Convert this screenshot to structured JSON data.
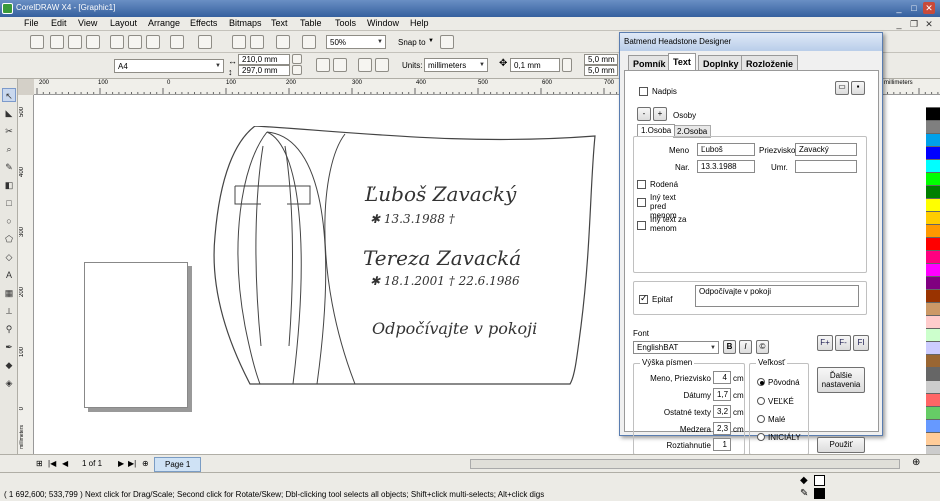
{
  "window": {
    "title": "CorelDRAW X4 - [Graphic1]"
  },
  "menu": [
    "File",
    "Edit",
    "View",
    "Layout",
    "Arrange",
    "Effects",
    "Bitmaps",
    "Text",
    "Table",
    "Tools",
    "Window",
    "Help"
  ],
  "toolbar": {
    "zoom": "50%",
    "snap_to": "Snap to"
  },
  "property_bar": {
    "page_size": "A4",
    "width": "210,0 mm",
    "height": "297,0 mm",
    "units_label": "Units:",
    "units": "millimeters",
    "nudge": "0,1 mm",
    "dup_x": "5,0 mm",
    "dup_y": "5,0 mm"
  },
  "ruler": {
    "h_ticks": [
      "200",
      "100",
      "0",
      "100",
      "200",
      "300",
      "400",
      "500",
      "600",
      "700",
      "800",
      "900",
      "1000",
      "1100"
    ],
    "unit_label": "millimeters",
    "v_ticks": [
      "500",
      "400",
      "300",
      "200",
      "100",
      "0"
    ],
    "v_unit_label": "millimeters"
  },
  "artwork": {
    "name1": "Ľuboš  Zavacký",
    "date1": "✱ 13.3.1988      †",
    "name2": "Tereza  Zavacká",
    "date2": "✱ 18.1.2001   † 22.6.1986",
    "epitaph": "Odpočívajte v pokoji"
  },
  "page_nav": {
    "counter": "1 of 1",
    "page_tab": "Page 1"
  },
  "status": {
    "text": "( 1 692,600; 533,799 )  Next click for Drag/Scale; Second click for Rotate/Skew; Dbl-clicking tool selects all objects; Shift+click multi-selects; Alt+click digs"
  },
  "palette_colors": [
    "#ffffff",
    "#000000",
    "#7f7f7f",
    "#00a0e9",
    "#0000ff",
    "#00ffff",
    "#00ff00",
    "#008000",
    "#ffff00",
    "#ffcc00",
    "#ff9900",
    "#ff0000",
    "#ff0080",
    "#ff00ff",
    "#800080",
    "#993300",
    "#cc9966",
    "#ffcccc",
    "#ccffcc",
    "#ccccff",
    "#996633",
    "#666666",
    "#cccccc",
    "#ff6666",
    "#66cc66",
    "#6699ff",
    "#ffcc99"
  ],
  "dialog": {
    "title": "Batmend Headstone Designer",
    "tabs": [
      "Pomník",
      "Text",
      "Doplnky",
      "Rozloženie"
    ],
    "active_tab": "Text",
    "nadpis_label": "Nadpis",
    "osoby_label": "Osoby",
    "minus": "-",
    "plus": "+",
    "person_tabs": [
      "1.Osoba",
      "2.Osoba"
    ],
    "meno_label": "Meno",
    "meno_value": "Ľuboš",
    "priezvisko_label": "Priezvisko",
    "priezvisko_value": "Zavacký",
    "nar_label": "Nar.",
    "nar_value": "13.3.1988",
    "umr_label": "Umr.",
    "umr_value": "",
    "rodena_label": "Rodená",
    "iny_text_pred_label": "Iný text pred menom",
    "iny_text_za_label": "Iný text za menom",
    "epitaf_label": "Epitaf",
    "epitaf_value": "Odpočívajte v pokoji",
    "font_label": "Font",
    "font_value": "EnglishBAT",
    "bold": "B",
    "italic": "I",
    "vyska_title": "Výška písmen",
    "rows": [
      {
        "label": "Meno, Priezvisko",
        "value": "4",
        "unit": "cm"
      },
      {
        "label": "Dátumy",
        "value": "1,7",
        "unit": "cm"
      },
      {
        "label": "Ostatné texty",
        "value": "3,2",
        "cm": "",
        "unit": "cm"
      },
      {
        "label": "Medzera",
        "value": "2,3",
        "unit": "cm"
      },
      {
        "label": "Roztiahnutie",
        "value": "1",
        "unit": ""
      }
    ],
    "velkost_title": "Veľkosť",
    "velkost_options": [
      "Pôvodná",
      "VEĽKÉ",
      "Malé",
      "INICIÁLY"
    ],
    "velkost_selected": "Pôvodná",
    "dalsie_button": "Ďalšie nastavenia",
    "pouzit_button": "Použiť"
  }
}
